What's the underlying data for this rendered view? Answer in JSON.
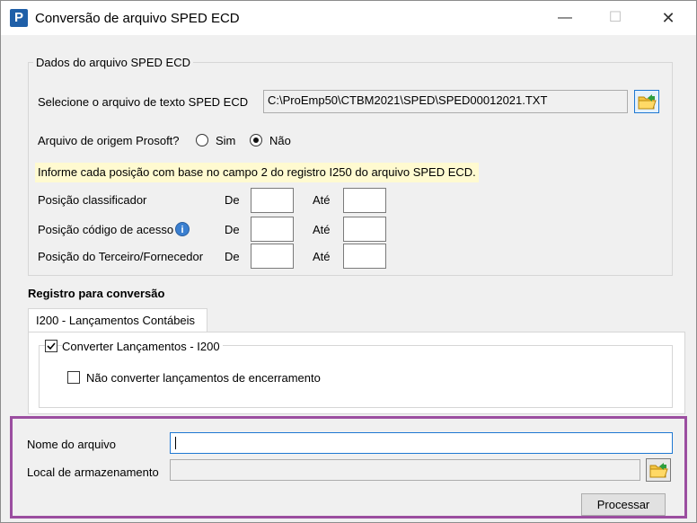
{
  "window": {
    "title": "Conversão de arquivo SPED ECD",
    "app_icon_letter": "P",
    "min_glyph": "—",
    "max_glyph": "☐",
    "close_glyph": "✕"
  },
  "sped_group": {
    "legend": "Dados do arquivo SPED ECD",
    "select_label": "Selecione o arquivo de texto SPED ECD",
    "file_path": "C:\\ProEmp50\\CTBM2021\\SPED\\SPED00012021.TXT",
    "origin_label": "Arquivo de origem Prosoft?",
    "origin_options": [
      {
        "label": "Sim",
        "selected": false
      },
      {
        "label": "Não",
        "selected": true
      }
    ],
    "info_note": "Informe cada posição com base no campo 2 do registro I250 do arquivo SPED ECD.",
    "positions": [
      {
        "label": "Posição classificador",
        "from_label": "De",
        "to_label": "Até",
        "from_value": "",
        "to_value": ""
      },
      {
        "label": "Posição código de acesso",
        "from_label": "De",
        "to_label": "Até",
        "from_value": "",
        "to_value": ""
      },
      {
        "label": "Posição do Terceiro/Fornecedor",
        "from_label": "De",
        "to_label": "Até",
        "from_value": "",
        "to_value": ""
      }
    ]
  },
  "conversion": {
    "heading": "Registro para conversão",
    "tab_label": "I200 - Lançamentos Contábeis",
    "convert_label": "Converter Lançamentos - I200",
    "convert_checked": true,
    "skip_closing_label": "Não converter lançamentos de encerramento",
    "skip_closing_checked": false
  },
  "output": {
    "filename_label": "Nome do arquivo",
    "filename_value": "",
    "storage_label": "Local de armazenamento",
    "storage_value": "",
    "process_button": "Processar"
  },
  "colors": {
    "highlight_border": "#9b4ea0",
    "note_background": "#fffad0",
    "focus_border": "#1e78d2"
  }
}
